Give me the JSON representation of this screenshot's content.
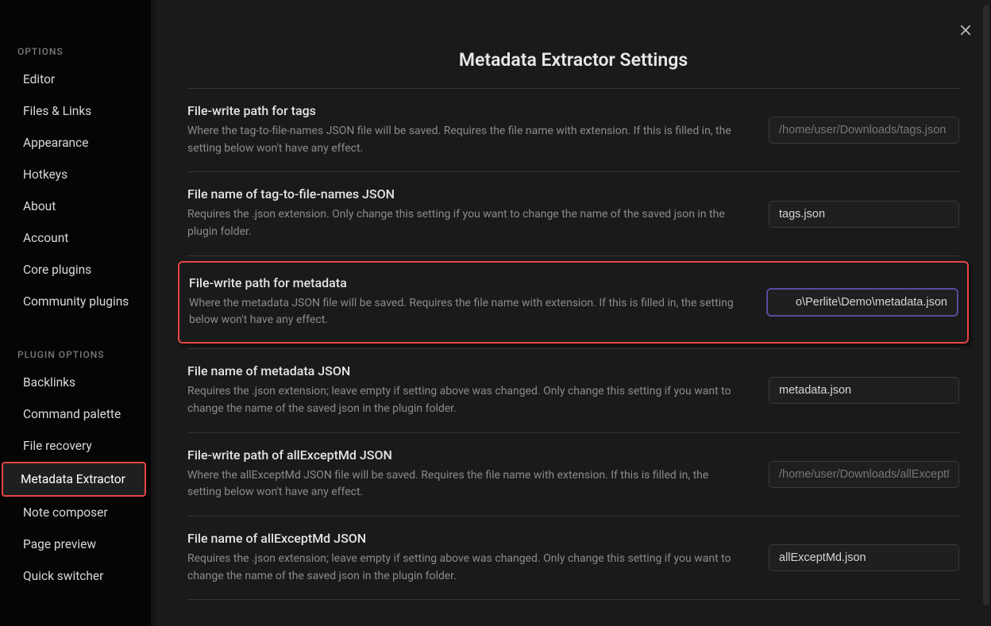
{
  "sidebar": {
    "options_heading": "OPTIONS",
    "options": [
      {
        "label": "Editor"
      },
      {
        "label": "Files & Links"
      },
      {
        "label": "Appearance"
      },
      {
        "label": "Hotkeys"
      },
      {
        "label": "About"
      },
      {
        "label": "Account"
      },
      {
        "label": "Core plugins"
      },
      {
        "label": "Community plugins"
      }
    ],
    "plugin_heading": "PLUGIN OPTIONS",
    "plugins": [
      {
        "label": "Backlinks"
      },
      {
        "label": "Command palette"
      },
      {
        "label": "File recovery"
      },
      {
        "label": "Metadata Extractor"
      },
      {
        "label": "Note composer"
      },
      {
        "label": "Page preview"
      },
      {
        "label": "Quick switcher"
      }
    ]
  },
  "main": {
    "title": "Metadata Extractor Settings",
    "settings": [
      {
        "name": "File-write path for tags",
        "desc": "Where the tag-to-file-names JSON file will be saved. Requires the file name with extension. If this is filled in, the setting below won't have any effect.",
        "value": "",
        "placeholder": "/home/user/Downloads/tags.json"
      },
      {
        "name": "File name of tag-to-file-names JSON",
        "desc": "Requires the .json extension. Only change this setting if you want to change the name of the saved json in the plugin folder.",
        "value": "tags.json",
        "placeholder": ""
      },
      {
        "name": "File-write path for metadata",
        "desc": "Where the metadata JSON file will be saved. Requires the file name with extension. If this is filled in, the setting below won't have any effect.",
        "value": "o\\Perlite\\Demo\\metadata.json",
        "placeholder": ""
      },
      {
        "name": "File name of metadata JSON",
        "desc": "Requires the .json extension; leave empty if setting above was changed. Only change this setting if you want to change the name of the saved json in the plugin folder.",
        "value": "metadata.json",
        "placeholder": ""
      },
      {
        "name": "File-write path of allExceptMd JSON",
        "desc": "Where the allExceptMd JSON file will be saved. Requires the file name with extension. If this is filled in, the setting below won't have any effect.",
        "value": "",
        "placeholder": "/home/user/Downloads/allExceptMd"
      },
      {
        "name": "File name of allExceptMd JSON",
        "desc": "Requires the .json extension; leave empty if setting above was changed. Only change this setting if you want to change the name of the saved json in the plugin folder.",
        "value": "allExceptMd.json",
        "placeholder": ""
      }
    ]
  }
}
